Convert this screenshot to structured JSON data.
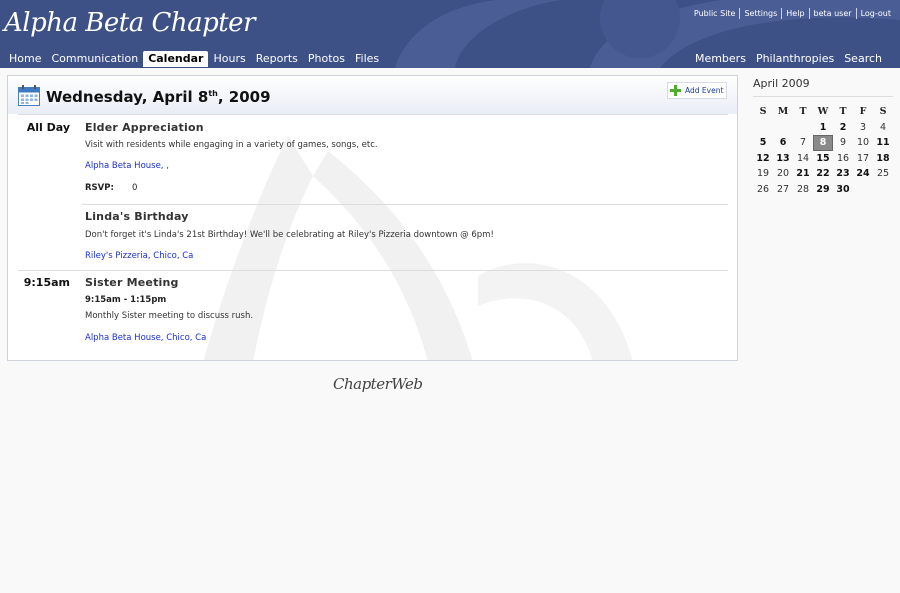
{
  "brand": {
    "name": "Alpha Beta Chapter"
  },
  "util_links": [
    "Public Site",
    "Settings",
    "Help",
    "beta user",
    "Log-out"
  ],
  "nav": {
    "left": [
      "Home",
      "Communication",
      "Calendar",
      "Hours",
      "Reports",
      "Photos",
      "Files"
    ],
    "active": "Calendar",
    "right": [
      "Members",
      "Philanthropies",
      "Search"
    ]
  },
  "day_view": {
    "title_prefix": "Wednesday, April 8",
    "title_suffix": "th",
    "title_year": ", 2009",
    "add_event_label": "Add Event",
    "sections": [
      {
        "time": "All Day",
        "events": [
          {
            "title": "Elder Appreciation",
            "description": "Visit with residents while engaging in a variety of games, songs, etc.",
            "location": "Alpha Beta House, ,",
            "rsvp_label": "RSVP:",
            "rsvp_value": "0"
          },
          {
            "title": "Linda's Birthday",
            "description": "Don't forget it's Linda's 21st Birthday! We'll be celebrating at Riley's Pizzeria downtown @ 6pm!",
            "location": "Riley's Pizzeria, Chico, Ca"
          }
        ]
      },
      {
        "time": "9:15am",
        "events": [
          {
            "title": "Sister Meeting",
            "time_range": "9:15am - 1:15pm",
            "description": "Monthly Sister meeting to discuss rush.",
            "location": "Alpha Beta House, Chico, Ca"
          }
        ]
      }
    ]
  },
  "footer": {
    "logo": "ChapterWeb"
  },
  "mini_calendar": {
    "title": "April 2009",
    "weekdays": [
      "S",
      "M",
      "T",
      "W",
      "T",
      "F",
      "S"
    ],
    "first_weekday": 3,
    "days_in_month": 30,
    "today": 8,
    "event_days": [
      1,
      2,
      5,
      6,
      11,
      12,
      13,
      15,
      18,
      21,
      22,
      23,
      24,
      29,
      30
    ]
  },
  "colors": {
    "header": "#3d5187",
    "link": "#1a2fd6",
    "today": "#8a8a8a"
  }
}
